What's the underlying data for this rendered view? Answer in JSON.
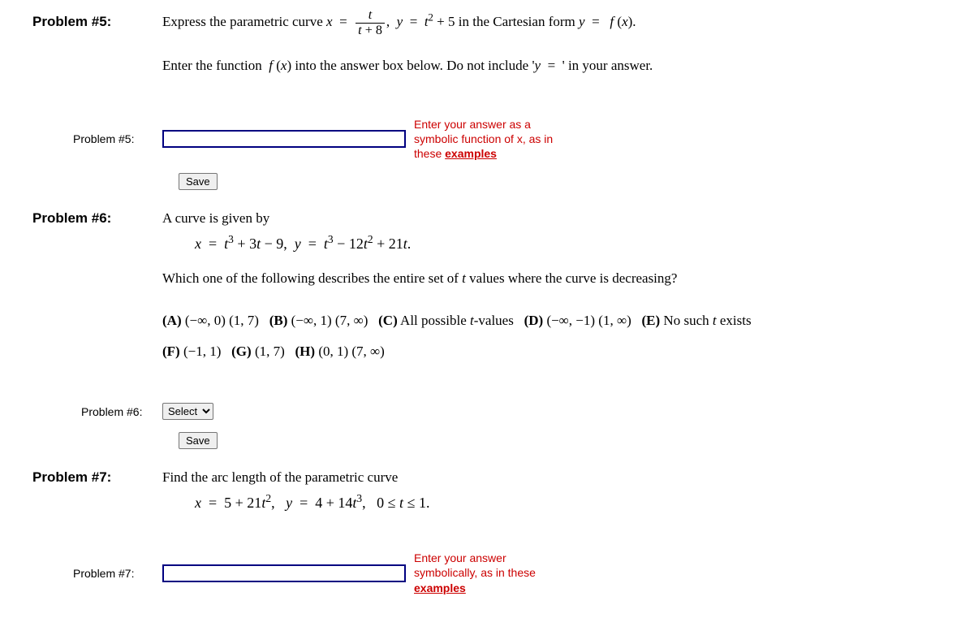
{
  "p5": {
    "heading": "Problem #5:",
    "text_a": "Express the parametric curve ",
    "frac_num": "t",
    "frac_den": "t + 8",
    "text_b": " in the Cartesian form ",
    "instr": "Enter the function  f (x) into the answer box below. Do not include 'y  =  ' in your answer.",
    "answer_label": "Problem #5:",
    "hint1": "Enter your answer as a",
    "hint2": "symbolic function of x, as in",
    "hint3": "these ",
    "hint_link": "examples",
    "save": "Save"
  },
  "p6": {
    "heading": "Problem #6:",
    "intro": "A curve is given by",
    "eq": "x  =  t³ + 3t − 9,   y  =  t³ − 12t² + 21t.",
    "question": "Which one of the following describes the entire set of t values where the curve is decreasing?",
    "optA": "(−∞, 0) (1, 7)",
    "optB": "(−∞, 1) (7, ∞)",
    "optC": "All possible t-values",
    "optD": "(−∞, −1) (1, ∞)",
    "optE": "No such t exists",
    "optF": "(−1, 1)",
    "optG": "(1, 7)",
    "optH": "(0, 1) (7, ∞)",
    "answer_label": "Problem #6:",
    "select_default": "Select",
    "save": "Save"
  },
  "p7": {
    "heading": "Problem #7:",
    "intro": "Find the arc length of the parametric curve",
    "eq": "x  =  5 + 21t²,    y  =  4 + 14t³,    0 ≤ t ≤ 1.",
    "answer_label": "Problem #7:",
    "hint1": "Enter your answer",
    "hint2": "symbolically, as in these",
    "hint_link": "examples"
  }
}
